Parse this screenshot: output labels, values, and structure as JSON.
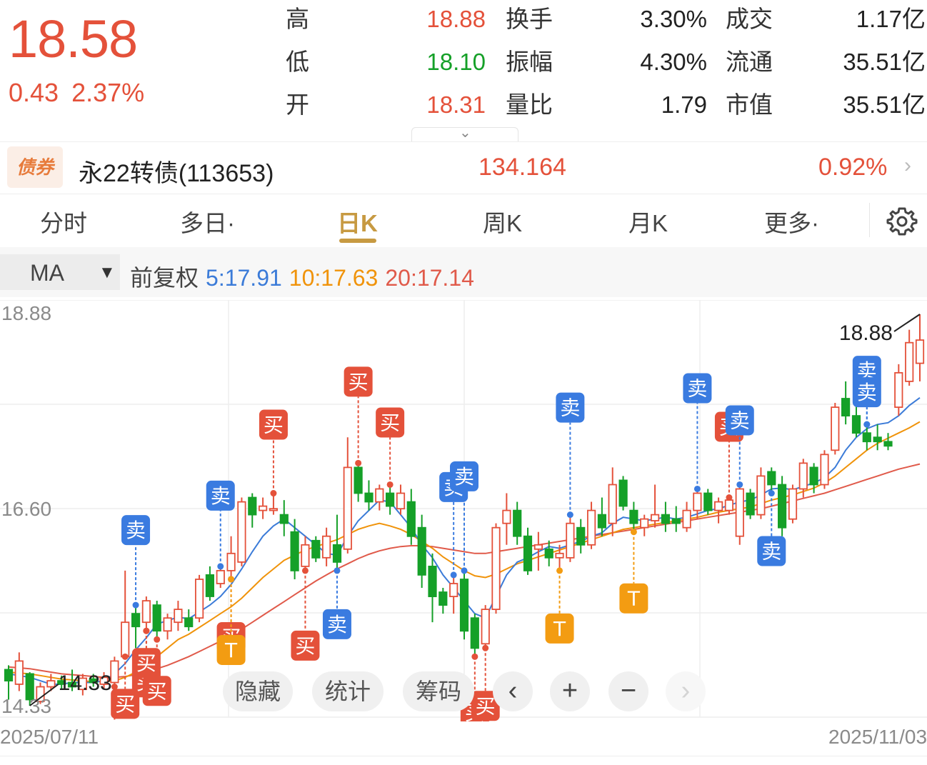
{
  "quote": {
    "price": "18.58",
    "change": "0.43",
    "change_pct": "2.37%",
    "stats": [
      {
        "label": "高",
        "value": "18.88",
        "color": "red"
      },
      {
        "label": "低",
        "value": "18.10",
        "color": "green"
      },
      {
        "label": "开",
        "value": "18.31",
        "color": "red"
      },
      {
        "label": "换手",
        "value": "3.30%"
      },
      {
        "label": "振幅",
        "value": "4.30%"
      },
      {
        "label": "量比",
        "value": "1.79"
      },
      {
        "label": "成交",
        "value": "1.17亿"
      },
      {
        "label": "流通",
        "value": "35.51亿"
      },
      {
        "label": "市值",
        "value": "35.51亿"
      }
    ],
    "expand_icon": "chevron-down-icon"
  },
  "bond": {
    "tag": "债券",
    "name": "永22转债(113653)",
    "price": "134.164",
    "change_pct": "0.92%",
    "arrow_icon": "chevron-right-icon"
  },
  "tabs": [
    {
      "label": "分时"
    },
    {
      "label": "多日·"
    },
    {
      "label": "日K",
      "active": true
    },
    {
      "label": "周K"
    },
    {
      "label": "月K"
    },
    {
      "label": "更多·"
    }
  ],
  "settings_icon": "gear-icon",
  "ma_bar": {
    "select_value": "MA",
    "adjust": "前复权",
    "ma5": "5:17.91",
    "ma10": "10:17.63",
    "ma20": "20:17.14"
  },
  "chart_data": {
    "type": "candlestick",
    "y_axis_labels": [
      "18.88",
      "16.60",
      "14.33"
    ],
    "ylim": [
      14.33,
      18.88
    ],
    "x_axis_labels": [
      "2025/07/11",
      "2025/11/03"
    ],
    "high_marker": "18.88",
    "low_marker": "14.33",
    "colors": {
      "up": "#e4513a",
      "down": "#15a028",
      "ma5": "#3b7bd8",
      "ma10": "#f0930a",
      "ma20": "#e05a4a",
      "buy": "#e4513a",
      "sell": "#3a7be0",
      "t": "#f39c12"
    },
    "candles": [
      {
        "o": 14.75,
        "h": 14.8,
        "l": 14.4,
        "c": 14.62
      },
      {
        "o": 14.58,
        "h": 14.95,
        "l": 14.5,
        "c": 14.85
      },
      {
        "o": 14.7,
        "h": 14.72,
        "l": 14.33,
        "c": 14.4
      },
      {
        "o": 14.38,
        "h": 14.6,
        "l": 14.35,
        "c": 14.55
      },
      {
        "o": 14.55,
        "h": 14.7,
        "l": 14.5,
        "c": 14.62
      },
      {
        "o": 14.62,
        "h": 14.68,
        "l": 14.52,
        "c": 14.58
      },
      {
        "o": 14.6,
        "h": 14.75,
        "l": 14.5,
        "c": 14.55
      },
      {
        "o": 14.52,
        "h": 14.7,
        "l": 14.45,
        "c": 14.65
      },
      {
        "o": 14.64,
        "h": 14.7,
        "l": 14.55,
        "c": 14.6
      },
      {
        "o": 14.58,
        "h": 14.72,
        "l": 14.52,
        "c": 14.66
      },
      {
        "o": 14.6,
        "h": 14.9,
        "l": 14.55,
        "c": 14.85
      },
      {
        "o": 14.9,
        "h": 15.9,
        "l": 14.9,
        "c": 15.3
      },
      {
        "o": 15.4,
        "h": 15.5,
        "l": 15.0,
        "c": 15.25
      },
      {
        "o": 15.3,
        "h": 15.6,
        "l": 15.2,
        "c": 15.55
      },
      {
        "o": 15.5,
        "h": 15.55,
        "l": 15.1,
        "c": 15.2
      },
      {
        "o": 15.2,
        "h": 15.4,
        "l": 15.1,
        "c": 15.35
      },
      {
        "o": 15.3,
        "h": 15.55,
        "l": 15.2,
        "c": 15.45
      },
      {
        "o": 15.35,
        "h": 15.45,
        "l": 15.2,
        "c": 15.25
      },
      {
        "o": 15.35,
        "h": 15.85,
        "l": 15.3,
        "c": 15.8
      },
      {
        "o": 15.85,
        "h": 15.95,
        "l": 15.55,
        "c": 15.6
      },
      {
        "o": 15.75,
        "h": 15.95,
        "l": 15.7,
        "c": 15.9
      },
      {
        "o": 15.9,
        "h": 16.3,
        "l": 15.8,
        "c": 16.1
      },
      {
        "o": 16.0,
        "h": 16.75,
        "l": 15.95,
        "c": 16.7
      },
      {
        "o": 16.75,
        "h": 16.8,
        "l": 16.4,
        "c": 16.55
      },
      {
        "o": 16.6,
        "h": 16.75,
        "l": 16.5,
        "c": 16.65
      },
      {
        "o": 16.6,
        "h": 16.8,
        "l": 16.55,
        "c": 16.62
      },
      {
        "o": 16.55,
        "h": 16.72,
        "l": 16.3,
        "c": 16.45
      },
      {
        "o": 16.35,
        "h": 16.5,
        "l": 15.8,
        "c": 15.9
      },
      {
        "o": 15.95,
        "h": 16.3,
        "l": 15.9,
        "c": 16.2
      },
      {
        "o": 16.25,
        "h": 16.3,
        "l": 16.0,
        "c": 16.05
      },
      {
        "o": 16.05,
        "h": 16.4,
        "l": 15.95,
        "c": 16.3
      },
      {
        "o": 16.2,
        "h": 16.55,
        "l": 15.9,
        "c": 16.0
      },
      {
        "o": 16.15,
        "h": 17.45,
        "l": 16.1,
        "c": 17.1
      },
      {
        "o": 17.1,
        "h": 17.15,
        "l": 16.7,
        "c": 16.8
      },
      {
        "o": 16.8,
        "h": 16.95,
        "l": 16.6,
        "c": 16.7
      },
      {
        "o": 16.7,
        "h": 16.9,
        "l": 16.6,
        "c": 16.85
      },
      {
        "o": 16.8,
        "h": 16.9,
        "l": 16.55,
        "c": 16.65
      },
      {
        "o": 16.62,
        "h": 16.9,
        "l": 16.55,
        "c": 16.8
      },
      {
        "o": 16.7,
        "h": 16.85,
        "l": 16.2,
        "c": 16.3
      },
      {
        "o": 16.4,
        "h": 16.55,
        "l": 15.7,
        "c": 15.85
      },
      {
        "o": 15.95,
        "h": 16.1,
        "l": 15.3,
        "c": 15.6
      },
      {
        "o": 15.65,
        "h": 15.7,
        "l": 15.4,
        "c": 15.5
      },
      {
        "o": 15.6,
        "h": 15.85,
        "l": 15.4,
        "c": 15.75
      },
      {
        "o": 15.8,
        "h": 15.9,
        "l": 15.1,
        "c": 15.2
      },
      {
        "o": 15.35,
        "h": 15.4,
        "l": 14.9,
        "c": 15.0
      },
      {
        "o": 15.05,
        "h": 15.5,
        "l": 15.0,
        "c": 15.45
      },
      {
        "o": 15.45,
        "h": 16.45,
        "l": 15.4,
        "c": 16.4
      },
      {
        "o": 16.45,
        "h": 16.8,
        "l": 16.2,
        "c": 16.6
      },
      {
        "o": 16.6,
        "h": 16.7,
        "l": 16.2,
        "c": 16.3
      },
      {
        "o": 16.3,
        "h": 16.4,
        "l": 15.85,
        "c": 15.9
      },
      {
        "o": 16.15,
        "h": 16.35,
        "l": 15.9,
        "c": 16.2
      },
      {
        "o": 16.15,
        "h": 16.25,
        "l": 15.95,
        "c": 16.05
      },
      {
        "o": 16.05,
        "h": 16.2,
        "l": 15.9,
        "c": 16.1
      },
      {
        "o": 16.05,
        "h": 16.55,
        "l": 16.0,
        "c": 16.45
      },
      {
        "o": 16.4,
        "h": 16.5,
        "l": 16.1,
        "c": 16.2
      },
      {
        "o": 16.2,
        "h": 16.7,
        "l": 16.15,
        "c": 16.6
      },
      {
        "o": 16.55,
        "h": 16.75,
        "l": 16.3,
        "c": 16.4
      },
      {
        "o": 16.45,
        "h": 17.1,
        "l": 16.3,
        "c": 16.9
      },
      {
        "o": 16.95,
        "h": 17.0,
        "l": 16.6,
        "c": 16.65
      },
      {
        "o": 16.6,
        "h": 16.7,
        "l": 16.35,
        "c": 16.45
      },
      {
        "o": 16.4,
        "h": 16.55,
        "l": 16.3,
        "c": 16.5
      },
      {
        "o": 16.48,
        "h": 16.9,
        "l": 16.4,
        "c": 16.55
      },
      {
        "o": 16.55,
        "h": 16.7,
        "l": 16.35,
        "c": 16.45
      },
      {
        "o": 16.5,
        "h": 16.65,
        "l": 16.35,
        "c": 16.45
      },
      {
        "o": 16.4,
        "h": 16.7,
        "l": 16.35,
        "c": 16.6
      },
      {
        "o": 16.6,
        "h": 16.85,
        "l": 16.5,
        "c": 16.8
      },
      {
        "o": 16.8,
        "h": 16.85,
        "l": 16.55,
        "c": 16.6
      },
      {
        "o": 16.6,
        "h": 16.75,
        "l": 16.45,
        "c": 16.7
      },
      {
        "o": 16.6,
        "h": 16.75,
        "l": 16.55,
        "c": 16.72
      },
      {
        "o": 16.3,
        "h": 16.9,
        "l": 16.2,
        "c": 16.85
      },
      {
        "o": 16.8,
        "h": 16.85,
        "l": 16.5,
        "c": 16.55
      },
      {
        "o": 16.55,
        "h": 17.1,
        "l": 16.5,
        "c": 17.0
      },
      {
        "o": 17.05,
        "h": 17.1,
        "l": 16.8,
        "c": 16.9
      },
      {
        "o": 16.9,
        "h": 17.0,
        "l": 16.3,
        "c": 16.4
      },
      {
        "o": 16.5,
        "h": 16.9,
        "l": 16.45,
        "c": 16.85
      },
      {
        "o": 16.85,
        "h": 17.2,
        "l": 16.75,
        "c": 17.15
      },
      {
        "o": 17.1,
        "h": 17.15,
        "l": 16.8,
        "c": 16.9
      },
      {
        "o": 16.9,
        "h": 17.3,
        "l": 16.85,
        "c": 17.25
      },
      {
        "o": 17.3,
        "h": 17.85,
        "l": 17.25,
        "c": 17.8
      },
      {
        "o": 17.9,
        "h": 18.1,
        "l": 17.6,
        "c": 17.7
      },
      {
        "o": 17.7,
        "h": 17.85,
        "l": 17.45,
        "c": 17.5
      },
      {
        "o": 17.5,
        "h": 17.6,
        "l": 17.3,
        "c": 17.4
      },
      {
        "o": 17.45,
        "h": 17.6,
        "l": 17.3,
        "c": 17.4
      },
      {
        "o": 17.4,
        "h": 17.5,
        "l": 17.3,
        "c": 17.35
      },
      {
        "o": 17.8,
        "h": 18.3,
        "l": 17.7,
        "c": 18.2
      },
      {
        "o": 18.1,
        "h": 18.7,
        "l": 18.05,
        "c": 18.55
      },
      {
        "o": 18.31,
        "h": 18.88,
        "l": 18.1,
        "c": 18.58
      }
    ],
    "ma5": [
      14.7,
      14.68,
      14.66,
      14.62,
      14.58,
      14.58,
      14.6,
      14.6,
      14.6,
      14.62,
      14.7,
      14.82,
      14.98,
      15.12,
      15.28,
      15.32,
      15.36,
      15.34,
      15.42,
      15.5,
      15.6,
      15.74,
      15.92,
      16.12,
      16.3,
      16.42,
      16.5,
      16.4,
      16.3,
      16.2,
      16.1,
      16.08,
      16.3,
      16.48,
      16.6,
      16.72,
      16.7,
      16.55,
      16.4,
      16.2,
      16.05,
      15.85,
      15.7,
      15.55,
      15.4,
      15.35,
      15.6,
      15.85,
      16.0,
      16.05,
      16.12,
      16.18,
      16.16,
      16.2,
      16.24,
      16.3,
      16.34,
      16.45,
      16.52,
      16.5,
      16.48,
      16.5,
      16.52,
      16.5,
      16.52,
      16.56,
      16.6,
      16.62,
      16.66,
      16.7,
      16.72,
      16.78,
      16.85,
      16.86,
      16.84,
      16.88,
      16.92,
      16.98,
      17.1,
      17.3,
      17.45,
      17.55,
      17.6,
      17.62,
      17.7,
      17.82,
      17.91
    ],
    "ma10": [
      14.72,
      14.71,
      14.7,
      14.68,
      14.66,
      14.64,
      14.63,
      14.62,
      14.61,
      14.61,
      14.62,
      14.66,
      14.72,
      14.8,
      14.9,
      15.0,
      15.1,
      15.16,
      15.24,
      15.32,
      15.4,
      15.48,
      15.58,
      15.7,
      15.82,
      15.92,
      16.02,
      16.08,
      16.14,
      16.18,
      16.22,
      16.26,
      16.32,
      16.38,
      16.42,
      16.45,
      16.42,
      16.38,
      16.32,
      16.24,
      16.16,
      16.06,
      15.98,
      15.9,
      15.84,
      15.82,
      15.86,
      15.92,
      15.98,
      16.02,
      16.06,
      16.1,
      16.14,
      16.18,
      16.22,
      16.26,
      16.3,
      16.34,
      16.38,
      16.4,
      16.42,
      16.44,
      16.46,
      16.48,
      16.5,
      16.52,
      16.55,
      16.58,
      16.6,
      16.62,
      16.64,
      16.68,
      16.72,
      16.75,
      16.78,
      16.82,
      16.86,
      16.92,
      17.0,
      17.1,
      17.2,
      17.3,
      17.38,
      17.44,
      17.5,
      17.56,
      17.63
    ],
    "ma20": [
      14.78,
      14.77,
      14.76,
      14.74,
      14.72,
      14.7,
      14.69,
      14.68,
      14.67,
      14.66,
      14.66,
      14.67,
      14.69,
      14.72,
      14.76,
      14.8,
      14.85,
      14.9,
      14.96,
      15.02,
      15.08,
      15.15,
      15.22,
      15.3,
      15.38,
      15.46,
      15.54,
      15.62,
      15.7,
      15.78,
      15.85,
      15.92,
      15.98,
      16.04,
      16.09,
      16.13,
      16.16,
      16.18,
      16.19,
      16.19,
      16.18,
      16.16,
      16.14,
      16.12,
      16.1,
      16.1,
      16.12,
      16.14,
      16.16,
      16.18,
      16.2,
      16.22,
      16.24,
      16.26,
      16.28,
      16.3,
      16.32,
      16.34,
      16.36,
      16.38,
      16.4,
      16.42,
      16.44,
      16.46,
      16.48,
      16.5,
      16.52,
      16.54,
      16.56,
      16.58,
      16.6,
      16.62,
      16.65,
      16.68,
      16.71,
      16.74,
      16.77,
      16.8,
      16.84,
      16.88,
      16.92,
      16.96,
      17.0,
      17.04,
      17.08,
      17.11,
      17.14
    ],
    "signals": [
      {
        "i": 10,
        "type": "买",
        "dir": "down",
        "len": 1.1
      },
      {
        "i": 11,
        "type": "买",
        "dir": "down",
        "len": 0.75
      },
      {
        "i": 12,
        "type": "卖",
        "dir": "up",
        "len": 1.4
      },
      {
        "i": 13,
        "type": "买",
        "dir": "down",
        "len": 0.85
      },
      {
        "i": 13,
        "type": "买",
        "dir": "down",
        "len": 0.4
      },
      {
        "i": 14,
        "type": "买",
        "dir": "down",
        "len": 0.85
      },
      {
        "i": 20,
        "type": "卖",
        "dir": "up",
        "len": 1.3
      },
      {
        "i": 21,
        "type": "买",
        "dir": "down",
        "len": 1.0
      },
      {
        "i": 21,
        "type": "T",
        "dir": "down",
        "len": 1.3
      },
      {
        "i": 25,
        "type": "买",
        "dir": "up",
        "len": 1.25
      },
      {
        "i": 28,
        "type": "买",
        "dir": "down",
        "len": 1.4
      },
      {
        "i": 31,
        "type": "卖",
        "dir": "down",
        "len": 0.9
      },
      {
        "i": 33,
        "type": "买",
        "dir": "up",
        "len": 1.55
      },
      {
        "i": 36,
        "type": "买",
        "dir": "up",
        "len": 1.1
      },
      {
        "i": 42,
        "type": "卖",
        "dir": "up",
        "len": 1.7
      },
      {
        "i": 43,
        "type": "卖",
        "dir": "up",
        "len": 1.85
      },
      {
        "i": 44,
        "type": "买",
        "dir": "down",
        "len": 0.95
      },
      {
        "i": 45,
        "type": "买",
        "dir": "down",
        "len": 1.0
      },
      {
        "i": 52,
        "type": "T",
        "dir": "down",
        "len": 1.0
      },
      {
        "i": 53,
        "type": "卖",
        "dir": "up",
        "len": 2.15
      },
      {
        "i": 59,
        "type": "T",
        "dir": "down",
        "len": 1.2
      },
      {
        "i": 65,
        "type": "卖",
        "dir": "up",
        "len": 2.0
      },
      {
        "i": 68,
        "type": "买",
        "dir": "up",
        "len": 1.3
      },
      {
        "i": 69,
        "type": "卖",
        "dir": "up",
        "len": 1.15
      },
      {
        "i": 72,
        "type": "卖",
        "dir": "down",
        "len": 1.0
      },
      {
        "i": 81,
        "type": "卖",
        "dir": "up",
        "len": 0.9
      },
      {
        "i": 81,
        "type": "卖",
        "dir": "up",
        "len": 0.4
      }
    ]
  },
  "controls": {
    "hide": "隐藏",
    "stats": "统计",
    "chips": "筹码",
    "prev_icon": "chevron-left-icon",
    "zoom_in_icon": "plus-icon",
    "zoom_out_icon": "minus-icon",
    "next_icon": "chevron-right-icon"
  }
}
